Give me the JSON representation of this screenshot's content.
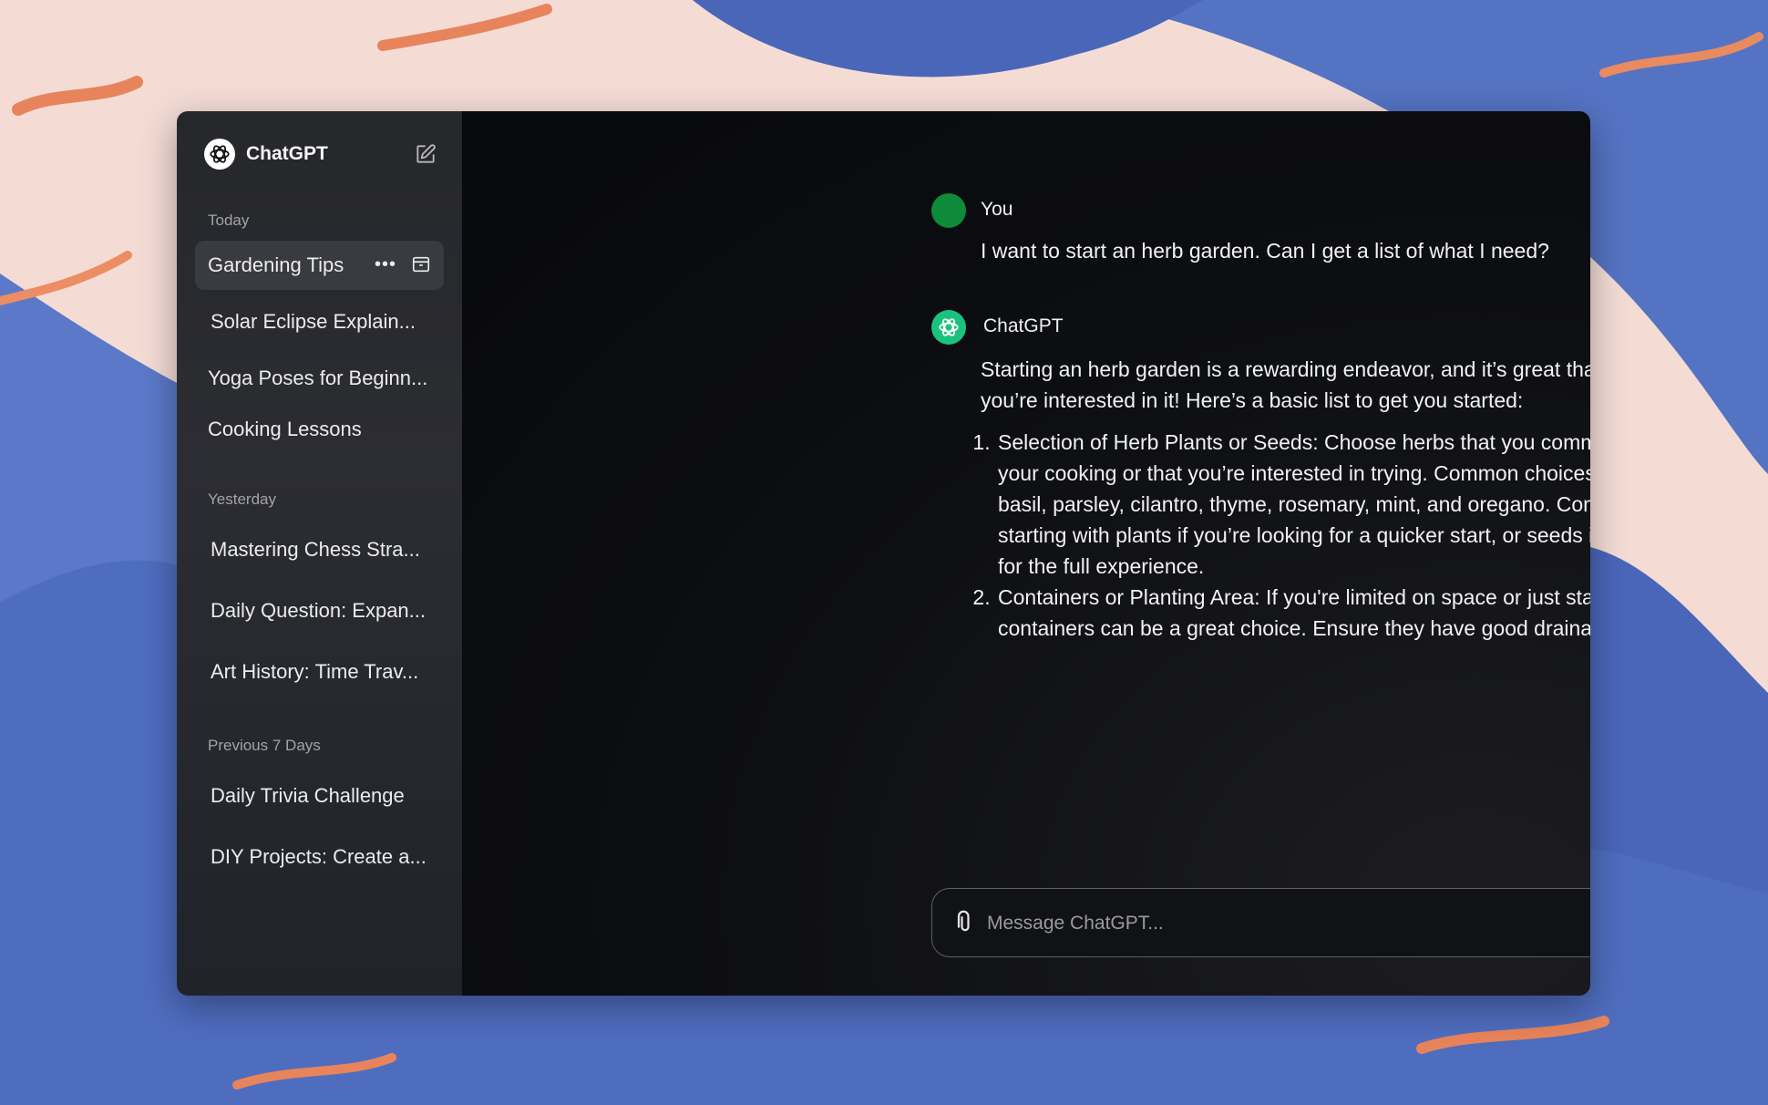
{
  "colors": {
    "accent_user": "#0d8a3a",
    "accent_gpt": "#19c37d"
  },
  "sidebar": {
    "brand": "ChatGPT",
    "sections": [
      {
        "label": "Today",
        "items": [
          "Gardening Tips",
          "Solar Eclipse Explain...",
          "Yoga Poses for Beginn...",
          "Cooking Lessons"
        ]
      },
      {
        "label": "Yesterday",
        "items": [
          "Mastering Chess Stra...",
          "Daily Question: Expan...",
          "Art History: Time Trav..."
        ]
      },
      {
        "label": "Previous 7 Days",
        "items": [
          "Daily Trivia Challenge",
          "DIY Projects: Create a..."
        ]
      }
    ],
    "active_item": "Gardening Tips",
    "icons": [
      "openai-logo-icon",
      "new-chat-icon",
      "more-options-icon",
      "archive-icon"
    ]
  },
  "conversation": {
    "user": {
      "name": "You",
      "text": "I want to start an herb garden. Can I get a list of what I need?"
    },
    "assistant": {
      "name": "ChatGPT",
      "intro": "Starting an herb garden is a rewarding endeavor, and it’s great that you’re interested in it! Here’s a basic list to get you started:",
      "list": [
        "Selection of Herb Plants or Seeds: Choose herbs that you commonly use in your cooking or that you’re interested in trying. Common choices include basil, parsley, cilantro, thyme, rosemary, mint, and oregano. Consider starting with plants if you’re looking for a quicker start, or seeds if you’re in it for the full experience.",
        "Containers or Planting Area: If you're limited on space or just starting out, containers can be a great choice. Ensure they have good drainage"
      ]
    }
  },
  "composer": {
    "placeholder": "Message ChatGPT...",
    "value": ""
  }
}
